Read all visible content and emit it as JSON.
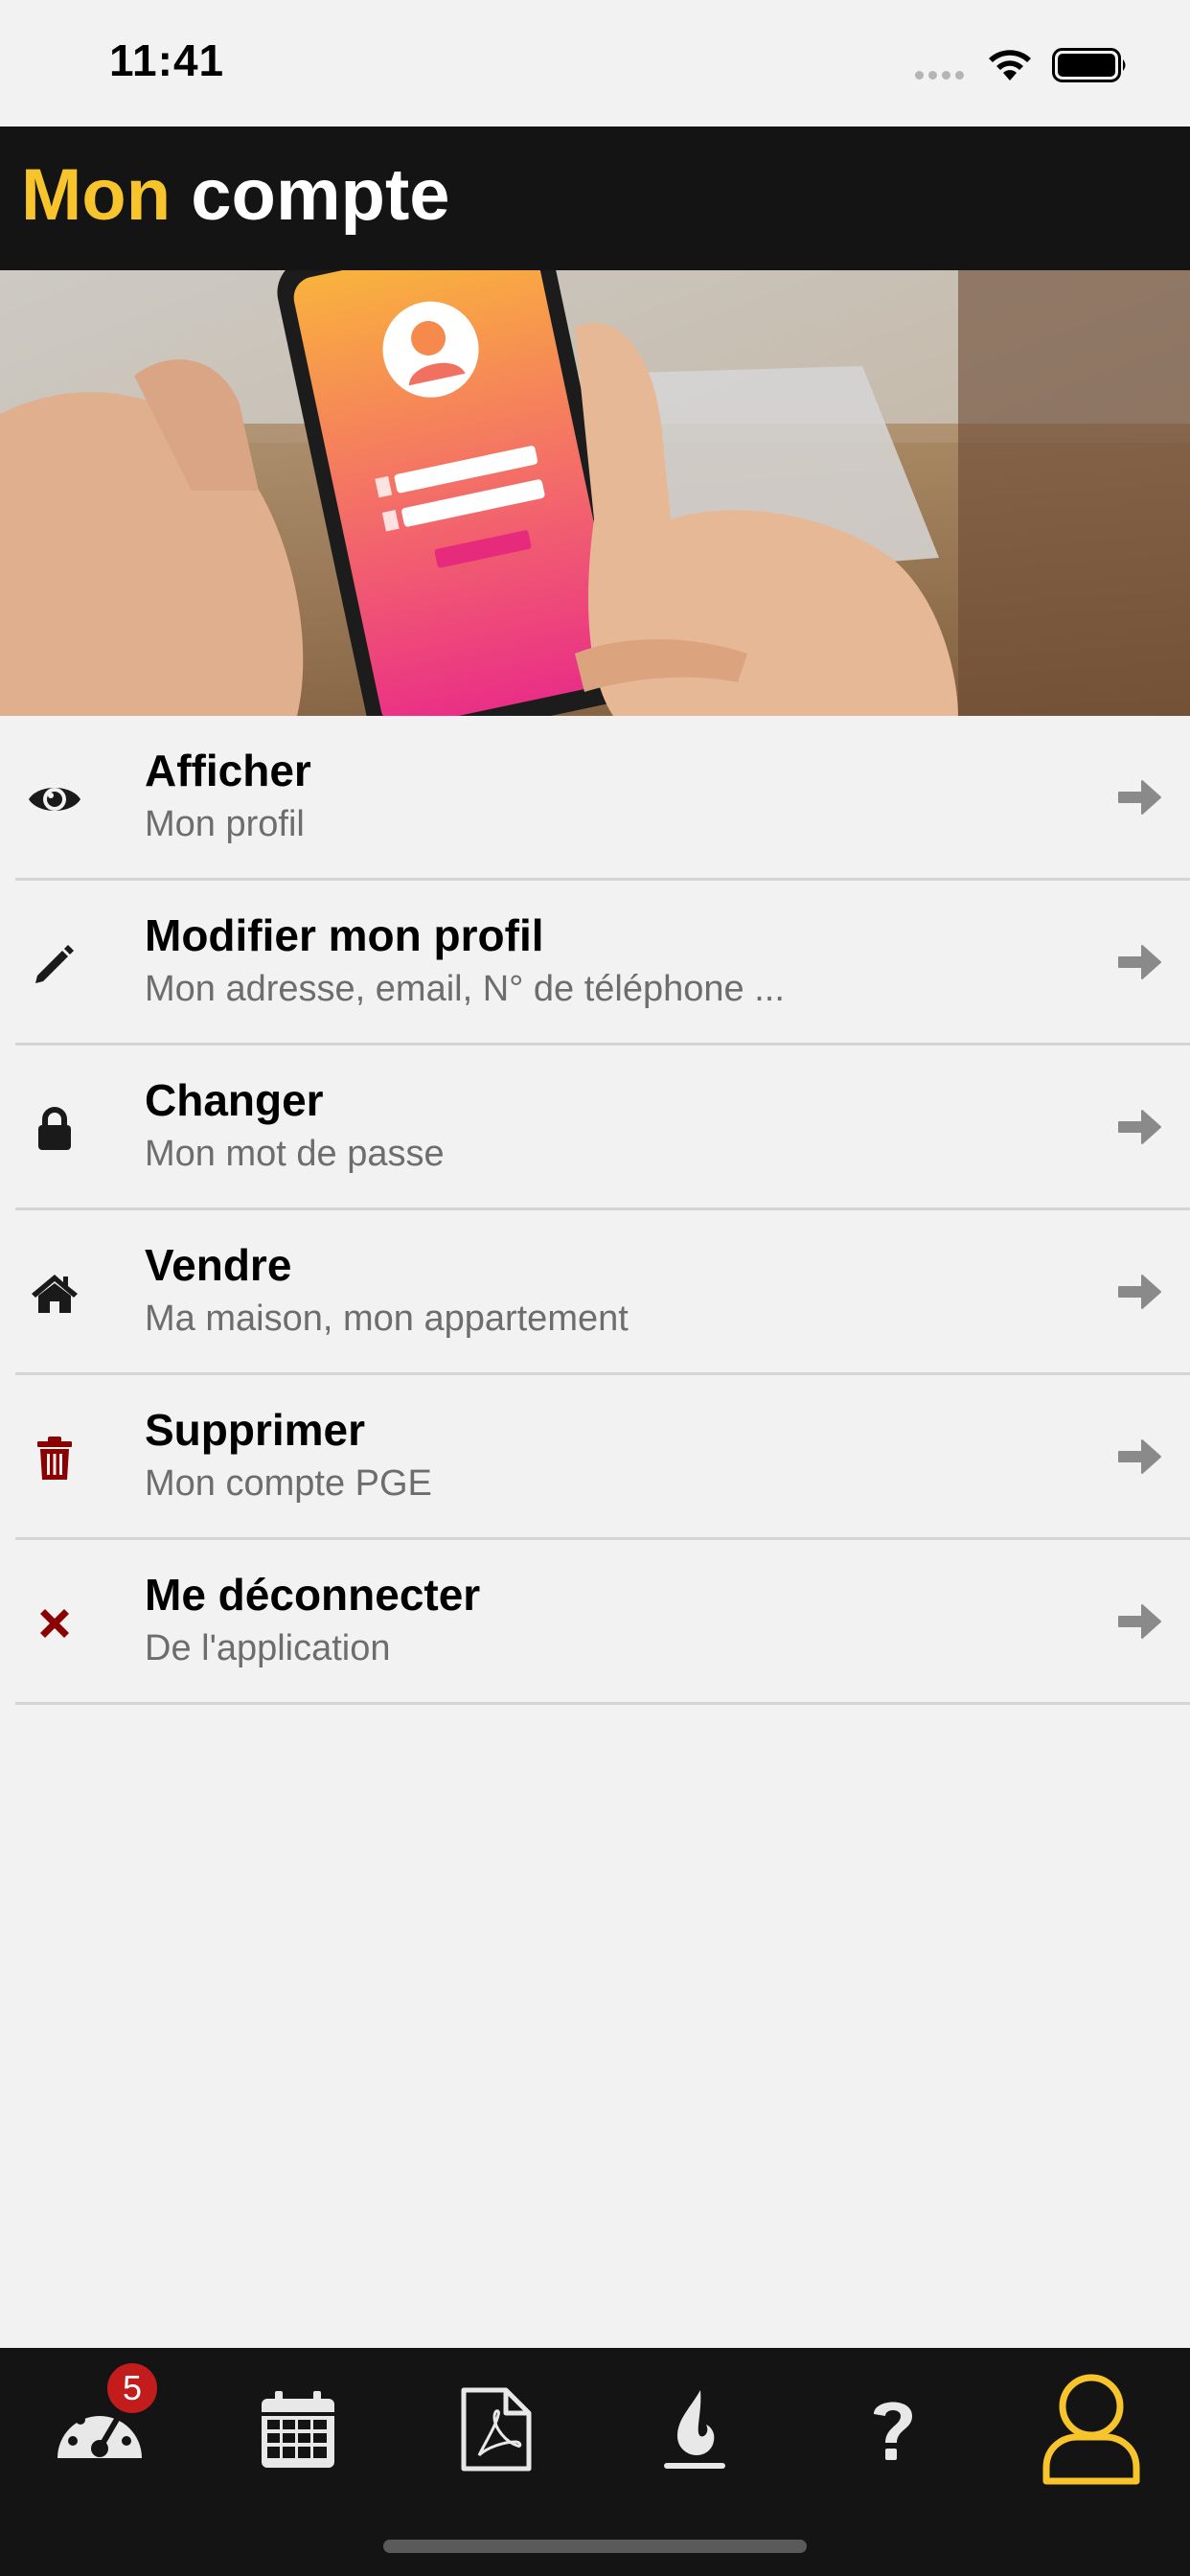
{
  "status_bar": {
    "time": "11:41"
  },
  "header": {
    "title_accent": "Mon",
    "title_main": "compte"
  },
  "menu": [
    {
      "title": "Afficher",
      "subtitle": "Mon profil",
      "icon": "eye-icon",
      "icon_color": "#1a1a1a"
    },
    {
      "title": "Modifier mon profil",
      "subtitle": "Mon adresse, email, N° de téléphone ...",
      "icon": "pencil-icon",
      "icon_color": "#1a1a1a"
    },
    {
      "title": "Changer",
      "subtitle": "Mon mot de passe",
      "icon": "lock-icon",
      "icon_color": "#1a1a1a"
    },
    {
      "title": "Vendre",
      "subtitle": "Ma maison, mon appartement",
      "icon": "home-icon",
      "icon_color": "#1a1a1a"
    },
    {
      "title": "Supprimer",
      "subtitle": "Mon compte PGE",
      "icon": "trash-icon",
      "icon_color": "#8b0000"
    },
    {
      "title": "Me déconnecter",
      "subtitle": "De l'application",
      "icon": "close-icon",
      "icon_color": "#8b0000"
    }
  ],
  "tab_bar": {
    "tabs": [
      {
        "icon": "dashboard-icon",
        "badge": "5"
      },
      {
        "icon": "calendar-icon"
      },
      {
        "icon": "pdf-icon"
      },
      {
        "icon": "flame-icon"
      },
      {
        "icon": "help-icon"
      },
      {
        "icon": "user-icon",
        "active": true
      }
    ]
  },
  "colors": {
    "accent": "#f8c42c",
    "header_bg": "#141414",
    "danger": "#8b0000",
    "badge": "#c31c1c"
  }
}
